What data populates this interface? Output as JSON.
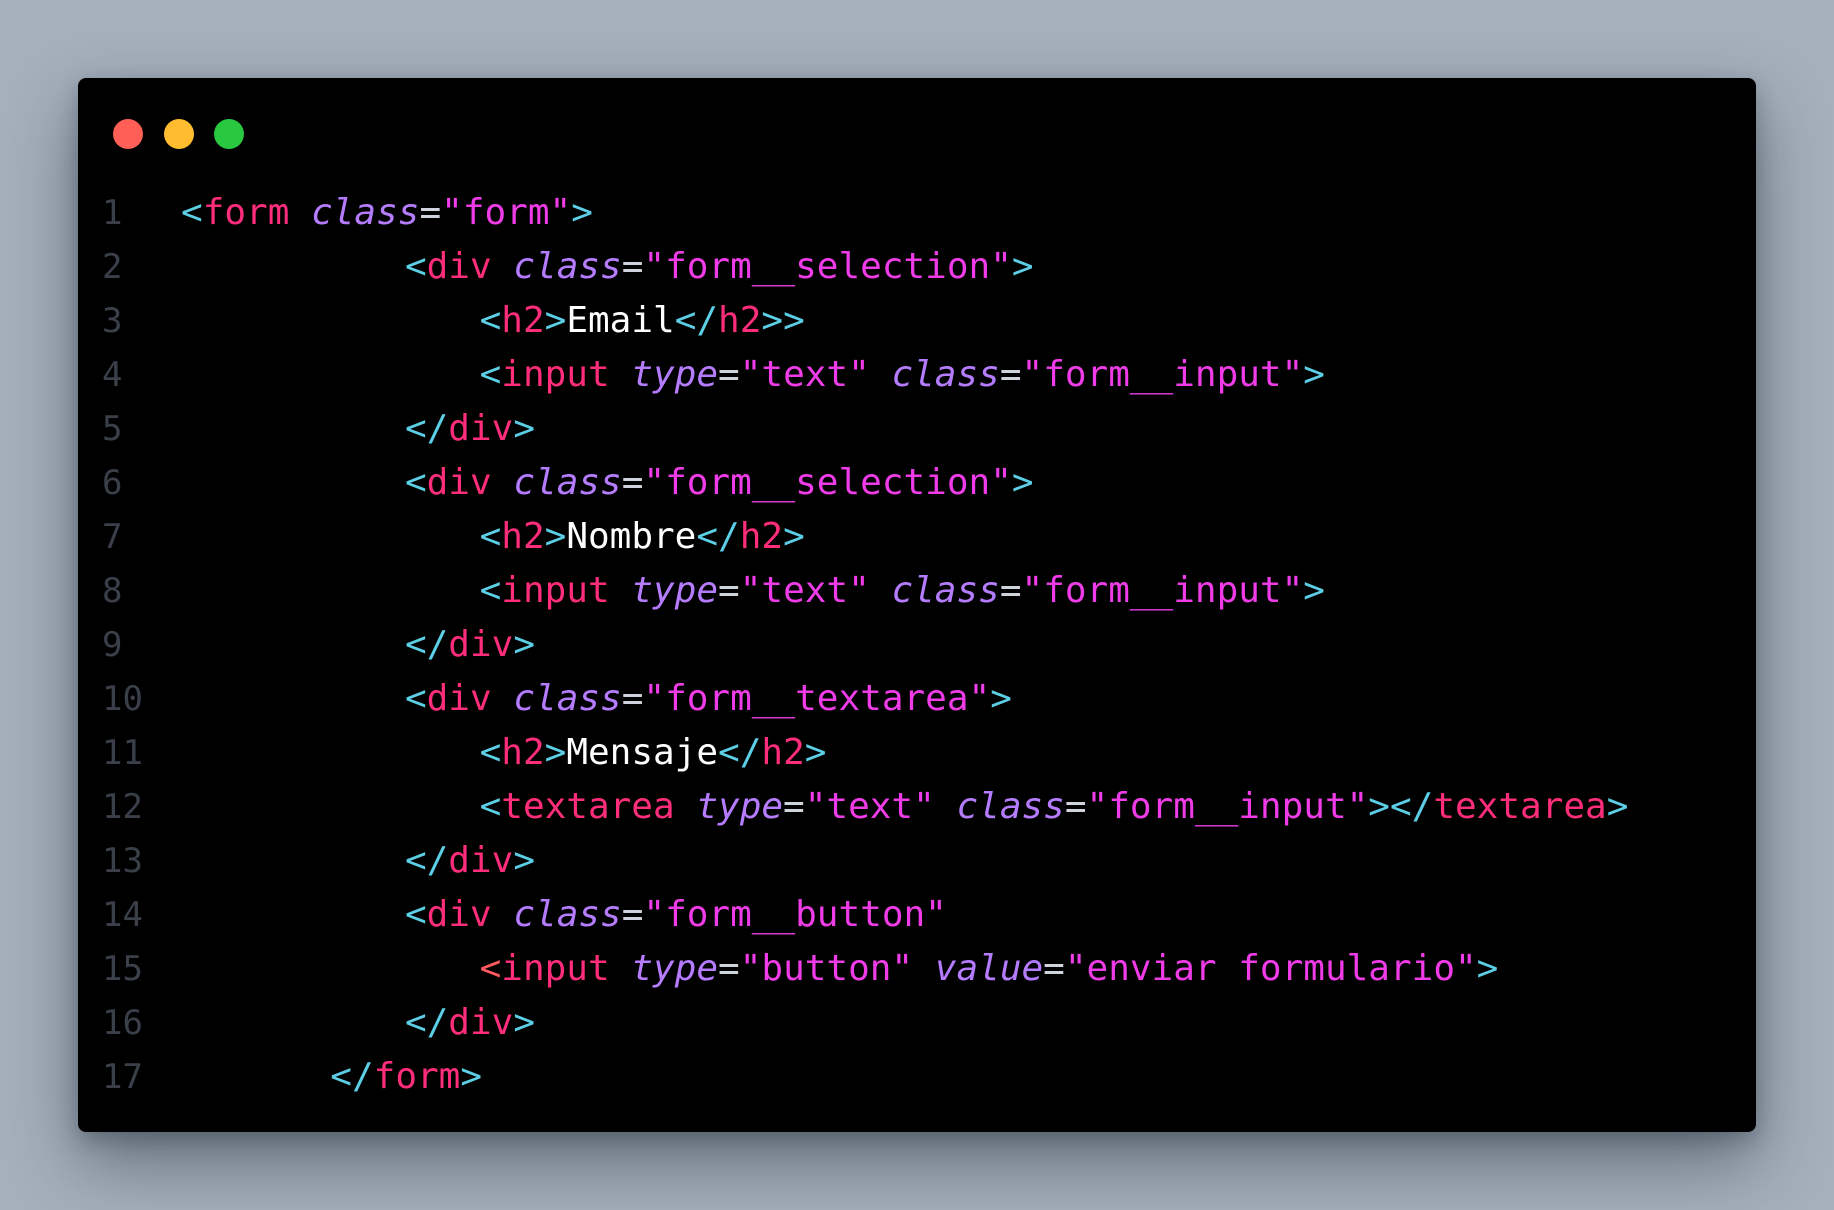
{
  "window": {
    "controls": [
      "close",
      "minimize",
      "zoom"
    ],
    "colors": {
      "close": "#ff5f57",
      "minimize": "#febc2e",
      "zoom": "#28c840",
      "background": "#000000",
      "tag": "#ff2d7a",
      "attribute": "#b57cff",
      "string": "#f03ce8",
      "punctuation": "#5ccfe6",
      "text": "#ffffff",
      "line_number": "#3b3f4a"
    }
  },
  "code": {
    "lines": [
      {
        "n": "1",
        "indent": 0,
        "tokens": [
          [
            "p",
            "<"
          ],
          [
            "t",
            "form"
          ],
          [
            "x",
            " "
          ],
          [
            "a",
            "class"
          ],
          [
            "e",
            "="
          ],
          [
            "s",
            "\"form\""
          ],
          [
            "p",
            ">"
          ]
        ]
      },
      {
        "n": "2",
        "indent": 12,
        "tokens": [
          [
            "p",
            "<"
          ],
          [
            "t",
            "div"
          ],
          [
            "x",
            " "
          ],
          [
            "a",
            "class"
          ],
          [
            "e",
            "="
          ],
          [
            "s",
            "\"form__selection\""
          ],
          [
            "p",
            ">"
          ]
        ]
      },
      {
        "n": "3",
        "indent": 16,
        "tokens": [
          [
            "p",
            "<"
          ],
          [
            "t",
            "h2"
          ],
          [
            "p",
            ">"
          ],
          [
            "x",
            "Email"
          ],
          [
            "p",
            "</"
          ],
          [
            "t",
            "h2"
          ],
          [
            "p",
            ">>"
          ]
        ]
      },
      {
        "n": "4",
        "indent": 16,
        "tokens": [
          [
            "p",
            "<"
          ],
          [
            "t",
            "input"
          ],
          [
            "x",
            " "
          ],
          [
            "a",
            "type"
          ],
          [
            "e",
            "="
          ],
          [
            "s",
            "\"text\""
          ],
          [
            "x",
            " "
          ],
          [
            "a",
            "class"
          ],
          [
            "e",
            "="
          ],
          [
            "s",
            "\"form__input\""
          ],
          [
            "p",
            ">"
          ]
        ]
      },
      {
        "n": "5",
        "indent": 12,
        "tokens": [
          [
            "p",
            "</"
          ],
          [
            "t",
            "div"
          ],
          [
            "p",
            ">"
          ]
        ]
      },
      {
        "n": "6",
        "indent": 12,
        "tokens": [
          [
            "p",
            "<"
          ],
          [
            "t",
            "div"
          ],
          [
            "x",
            " "
          ],
          [
            "a",
            "class"
          ],
          [
            "e",
            "="
          ],
          [
            "s",
            "\"form__selection\""
          ],
          [
            "p",
            ">"
          ]
        ]
      },
      {
        "n": "7",
        "indent": 16,
        "tokens": [
          [
            "p",
            "<"
          ],
          [
            "t",
            "h2"
          ],
          [
            "p",
            ">"
          ],
          [
            "x",
            "Nombre"
          ],
          [
            "p",
            "</"
          ],
          [
            "t",
            "h2"
          ],
          [
            "p",
            ">"
          ]
        ]
      },
      {
        "n": "8",
        "indent": 16,
        "tokens": [
          [
            "p",
            "<"
          ],
          [
            "t",
            "input"
          ],
          [
            "x",
            " "
          ],
          [
            "a",
            "type"
          ],
          [
            "e",
            "="
          ],
          [
            "s",
            "\"text\""
          ],
          [
            "x",
            " "
          ],
          [
            "a",
            "class"
          ],
          [
            "e",
            "="
          ],
          [
            "s",
            "\"form__input\""
          ],
          [
            "p",
            ">"
          ]
        ]
      },
      {
        "n": "9",
        "indent": 12,
        "tokens": [
          [
            "p",
            "</"
          ],
          [
            "t",
            "div"
          ],
          [
            "p",
            ">"
          ]
        ]
      },
      {
        "n": "10",
        "indent": 12,
        "tokens": [
          [
            "p",
            "<"
          ],
          [
            "t",
            "div"
          ],
          [
            "x",
            " "
          ],
          [
            "a",
            "class"
          ],
          [
            "e",
            "="
          ],
          [
            "s",
            "\"form__textarea\""
          ],
          [
            "p",
            ">"
          ]
        ]
      },
      {
        "n": "11",
        "indent": 16,
        "tokens": [
          [
            "p",
            "<"
          ],
          [
            "t",
            "h2"
          ],
          [
            "p",
            ">"
          ],
          [
            "x",
            "Mensaje"
          ],
          [
            "p",
            "</"
          ],
          [
            "t",
            "h2"
          ],
          [
            "p",
            ">"
          ]
        ]
      },
      {
        "n": "12",
        "indent": 16,
        "tokens": [
          [
            "p",
            "<"
          ],
          [
            "t",
            "textarea"
          ],
          [
            "x",
            " "
          ],
          [
            "a",
            "type"
          ],
          [
            "e",
            "="
          ],
          [
            "s",
            "\"text\""
          ],
          [
            "x",
            " "
          ],
          [
            "a",
            "class"
          ],
          [
            "e",
            "="
          ],
          [
            "s",
            "\"form__input\""
          ],
          [
            "p",
            "></"
          ],
          [
            "t",
            "textarea"
          ],
          [
            "p",
            ">"
          ]
        ]
      },
      {
        "n": "13",
        "indent": 12,
        "tokens": [
          [
            "p",
            "</"
          ],
          [
            "t",
            "div"
          ],
          [
            "p",
            ">"
          ]
        ]
      },
      {
        "n": "14",
        "indent": 12,
        "tokens": [
          [
            "p",
            "<"
          ],
          [
            "t",
            "div"
          ],
          [
            "x",
            " "
          ],
          [
            "a",
            "class"
          ],
          [
            "e",
            "="
          ],
          [
            "s",
            "\"form__button\""
          ]
        ]
      },
      {
        "n": "15",
        "indent": 16,
        "tokens": [
          [
            "w",
            "<"
          ],
          [
            "t",
            "input"
          ],
          [
            "x",
            " "
          ],
          [
            "a",
            "type"
          ],
          [
            "e",
            "="
          ],
          [
            "s",
            "\"button\""
          ],
          [
            "x",
            " "
          ],
          [
            "a",
            "value"
          ],
          [
            "e",
            "="
          ],
          [
            "s",
            "\"enviar formulario\""
          ],
          [
            "p",
            ">"
          ]
        ]
      },
      {
        "n": "16",
        "indent": 12,
        "tokens": [
          [
            "p",
            "</"
          ],
          [
            "t",
            "div"
          ],
          [
            "p",
            ">"
          ]
        ]
      },
      {
        "n": "17",
        "indent": 8,
        "tokens": [
          [
            "p",
            "</"
          ],
          [
            "t",
            "form"
          ],
          [
            "p",
            ">"
          ]
        ]
      }
    ]
  }
}
